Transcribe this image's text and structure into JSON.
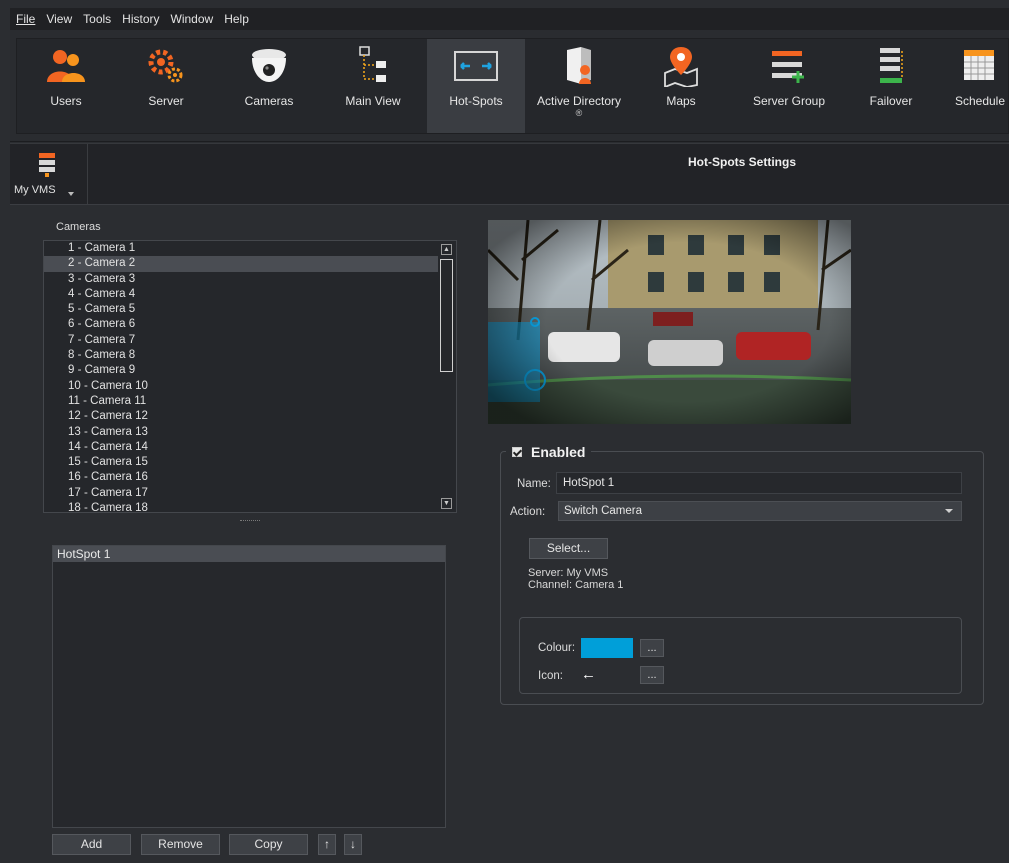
{
  "menu": [
    "File",
    "View",
    "Tools",
    "History",
    "Window",
    "Help"
  ],
  "toolbar": [
    {
      "label": "Users",
      "icon": "users-icon"
    },
    {
      "label": "Server",
      "icon": "server-gears-icon"
    },
    {
      "label": "Cameras",
      "icon": "dome-camera-icon"
    },
    {
      "label": "Main View",
      "icon": "main-view-tree-icon"
    },
    {
      "label": "Hot-Spots",
      "icon": "hotspots-icon",
      "active": true
    },
    {
      "label": "Active Directory",
      "sub": "®",
      "icon": "active-directory-icon"
    },
    {
      "label": "Maps",
      "icon": "map-pin-icon"
    },
    {
      "label": "Server Group",
      "icon": "server-group-icon"
    },
    {
      "label": "Failover",
      "icon": "failover-icon"
    },
    {
      "label": "Schedule",
      "icon": "schedule-icon"
    }
  ],
  "server_selector": {
    "label": "My VMS"
  },
  "panel_title": "Hot-Spots Settings",
  "cameras": {
    "label": "Cameras",
    "items": [
      "1 - Camera 1",
      "2 - Camera 2",
      "3 - Camera 3",
      "4 - Camera 4",
      "5 - Camera 5",
      "6 - Camera 6",
      "7 - Camera 7",
      "8 - Camera 8",
      "9 - Camera 9",
      "10 - Camera 10",
      "11 - Camera 11",
      "12 - Camera 12",
      "13 - Camera 13",
      "14 - Camera 14",
      "15 - Camera 15",
      "16 - Camera 16",
      "17 - Camera 17",
      "18 - Camera 18"
    ],
    "selected": "2 - Camera 2"
  },
  "hotspots": {
    "items": [
      "HotSpot 1"
    ]
  },
  "buttons": {
    "add": "Add",
    "remove": "Remove",
    "copy": "Copy",
    "up": "↑",
    "down": "↓"
  },
  "settings": {
    "enabled_label": "Enabled",
    "enabled": true,
    "name_label": "Name:",
    "name_value": "HotSpot 1",
    "action_label": "Action:",
    "action_value": "Switch Camera",
    "select_button": "Select...",
    "server_line": "Server: My VMS",
    "channel_line": "Channel: Camera 1",
    "colour_label": "Colour:",
    "colour_value": "#009fd9",
    "icon_label": "Icon:",
    "icon_value": "←",
    "more_button": "..."
  }
}
